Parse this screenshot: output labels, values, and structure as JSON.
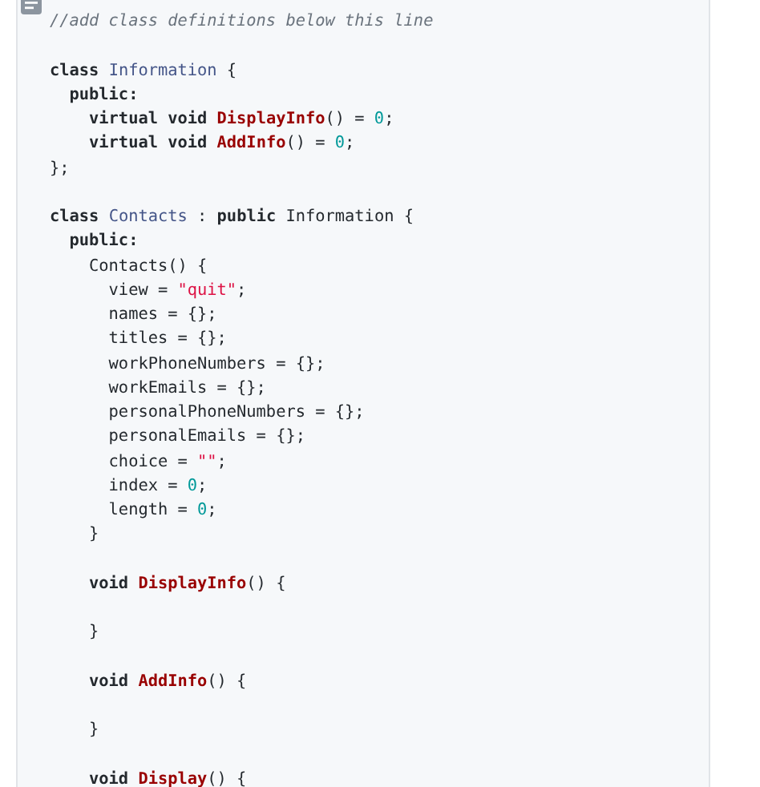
{
  "code_block": {
    "lines": [
      {
        "kind": "code",
        "tokens": [
          {
            "kind": "comment",
            "text": "//add class definitions below this line"
          }
        ]
      },
      {
        "kind": "blank"
      },
      {
        "kind": "code",
        "tokens": [
          {
            "kind": "keyword",
            "text": "class "
          },
          {
            "kind": "type",
            "text": "Information"
          },
          {
            "kind": "plain",
            "text": " {"
          }
        ]
      },
      {
        "kind": "code",
        "tokens": [
          {
            "kind": "keyword",
            "text": "  public:"
          }
        ]
      },
      {
        "kind": "code",
        "tokens": [
          {
            "kind": "keyword",
            "text": "    virtual void "
          },
          {
            "kind": "function",
            "text": "DisplayInfo"
          },
          {
            "kind": "plain",
            "text": "() = "
          },
          {
            "kind": "number",
            "text": "0"
          },
          {
            "kind": "plain",
            "text": ";"
          }
        ]
      },
      {
        "kind": "code",
        "tokens": [
          {
            "kind": "keyword",
            "text": "    virtual void "
          },
          {
            "kind": "function",
            "text": "AddInfo"
          },
          {
            "kind": "plain",
            "text": "() = "
          },
          {
            "kind": "number",
            "text": "0"
          },
          {
            "kind": "plain",
            "text": ";"
          }
        ]
      },
      {
        "kind": "code",
        "tokens": [
          {
            "kind": "plain",
            "text": "};"
          }
        ]
      },
      {
        "kind": "blank"
      },
      {
        "kind": "code",
        "tokens": [
          {
            "kind": "keyword",
            "text": "class "
          },
          {
            "kind": "type",
            "text": "Contacts"
          },
          {
            "kind": "plain",
            "text": " : "
          },
          {
            "kind": "keyword",
            "text": "public"
          },
          {
            "kind": "plain",
            "text": " Information {"
          }
        ]
      },
      {
        "kind": "code",
        "tokens": [
          {
            "kind": "keyword",
            "text": "  public:"
          }
        ]
      },
      {
        "kind": "code",
        "tokens": [
          {
            "kind": "plain",
            "text": "    Contacts() {"
          }
        ]
      },
      {
        "kind": "code",
        "tokens": [
          {
            "kind": "plain",
            "text": "      view = "
          },
          {
            "kind": "string",
            "text": "\"quit\""
          },
          {
            "kind": "plain",
            "text": ";"
          }
        ]
      },
      {
        "kind": "code",
        "tokens": [
          {
            "kind": "plain",
            "text": "      names = {};"
          }
        ]
      },
      {
        "kind": "code",
        "tokens": [
          {
            "kind": "plain",
            "text": "      titles = {};"
          }
        ]
      },
      {
        "kind": "code",
        "tokens": [
          {
            "kind": "plain",
            "text": "      workPhoneNumbers = {};"
          }
        ]
      },
      {
        "kind": "code",
        "tokens": [
          {
            "kind": "plain",
            "text": "      workEmails = {};"
          }
        ]
      },
      {
        "kind": "code",
        "tokens": [
          {
            "kind": "plain",
            "text": "      personalPhoneNumbers = {};"
          }
        ]
      },
      {
        "kind": "code",
        "tokens": [
          {
            "kind": "plain",
            "text": "      personalEmails = {};"
          }
        ]
      },
      {
        "kind": "code",
        "tokens": [
          {
            "kind": "plain",
            "text": "      choice = "
          },
          {
            "kind": "string",
            "text": "\"\""
          },
          {
            "kind": "plain",
            "text": ";"
          }
        ]
      },
      {
        "kind": "code",
        "tokens": [
          {
            "kind": "plain",
            "text": "      index = "
          },
          {
            "kind": "number",
            "text": "0"
          },
          {
            "kind": "plain",
            "text": ";"
          }
        ]
      },
      {
        "kind": "code",
        "tokens": [
          {
            "kind": "plain",
            "text": "      length = "
          },
          {
            "kind": "number",
            "text": "0"
          },
          {
            "kind": "plain",
            "text": ";"
          }
        ]
      },
      {
        "kind": "code",
        "tokens": [
          {
            "kind": "plain",
            "text": "    }"
          }
        ]
      },
      {
        "kind": "blank"
      },
      {
        "kind": "code",
        "tokens": [
          {
            "kind": "keyword",
            "text": "    void "
          },
          {
            "kind": "function",
            "text": "DisplayInfo"
          },
          {
            "kind": "plain",
            "text": "() {"
          }
        ]
      },
      {
        "kind": "blank"
      },
      {
        "kind": "code",
        "tokens": [
          {
            "kind": "plain",
            "text": "    }"
          }
        ]
      },
      {
        "kind": "blank"
      },
      {
        "kind": "code",
        "tokens": [
          {
            "kind": "keyword",
            "text": "    void "
          },
          {
            "kind": "function",
            "text": "AddInfo"
          },
          {
            "kind": "plain",
            "text": "() {"
          }
        ]
      },
      {
        "kind": "blank"
      },
      {
        "kind": "code",
        "tokens": [
          {
            "kind": "plain",
            "text": "    }"
          }
        ]
      },
      {
        "kind": "blank"
      },
      {
        "kind": "code",
        "tokens": [
          {
            "kind": "keyword",
            "text": "    void "
          },
          {
            "kind": "function",
            "text": "Display"
          },
          {
            "kind": "plain",
            "text": "() {"
          }
        ]
      }
    ]
  }
}
